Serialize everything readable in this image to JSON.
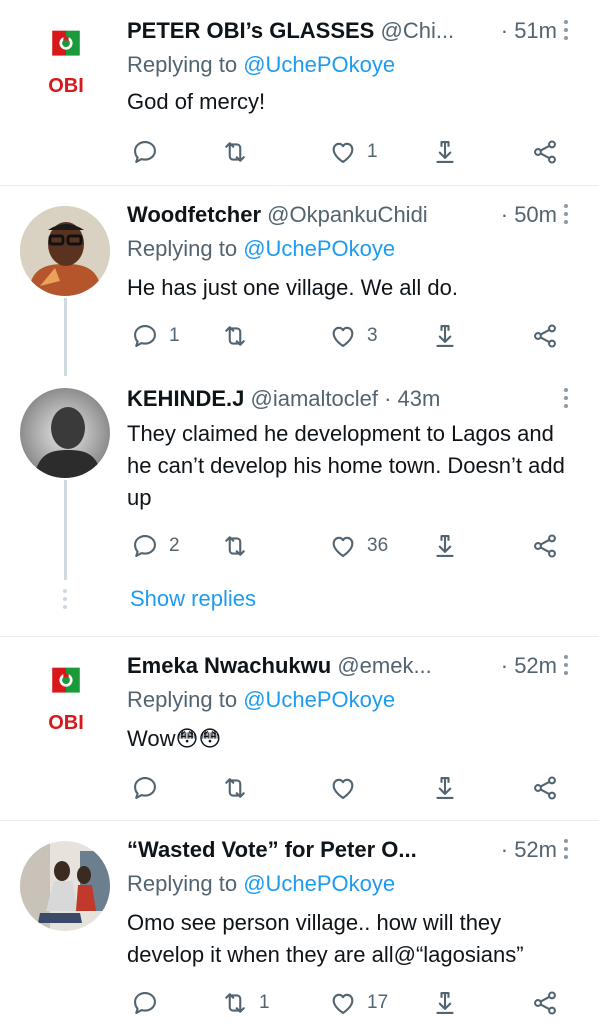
{
  "tweets": [
    {
      "name": "PETER OBI’s GLASSES",
      "handle": "@Chi...",
      "time": "· 51m",
      "reply_label": "Replying to ",
      "reply_to": "@UchePOkoye",
      "text": "God of mercy!",
      "reply_count": "",
      "retweet_count": "",
      "like_count": "1",
      "avatar_text": "OBI"
    },
    {
      "name": "Woodfetcher",
      "handle": "@OkpankuChidi",
      "time": "· 50m",
      "reply_label": "Replying to ",
      "reply_to": "@UchePOkoye",
      "text": "He has just one village. We all do.",
      "reply_count": "1",
      "retweet_count": "",
      "like_count": "3"
    },
    {
      "name": "KEHINDE.J",
      "handle": "@iamaltoclef",
      "time": "· 43m",
      "text": "They claimed he development to Lagos and he can’t develop his home town. Doesn’t add up",
      "reply_count": "2",
      "retweet_count": "",
      "like_count": "36",
      "show_replies": "Show replies"
    },
    {
      "name": "Emeka Nwachukwu",
      "handle": "@emek...",
      "time": "· 52m",
      "reply_label": "Replying to ",
      "reply_to": "@UchePOkoye",
      "text": "Wow😳😳",
      "reply_count": "",
      "retweet_count": "",
      "like_count": "",
      "avatar_text": "OBI"
    },
    {
      "name": "“Wasted Vote” for Peter O...",
      "handle": "",
      "time": "· 52m",
      "reply_label": "Replying to ",
      "reply_to": "@UchePOkoye",
      "text": "Omo see person village.. how will they develop it when they are all@“lagosians”",
      "reply_count": "",
      "retweet_count": "1",
      "like_count": "17"
    }
  ],
  "colors": {
    "link": "#1d9bf0",
    "muted": "#536471",
    "text": "#0f1419",
    "divider": "#e6ecf0",
    "obi_red": "#d7191c",
    "obi_green": "#1a9a3a"
  },
  "icons": [
    "reply-icon",
    "retweet-icon",
    "like-icon",
    "bookmark-icon",
    "share-icon",
    "more-icon"
  ]
}
